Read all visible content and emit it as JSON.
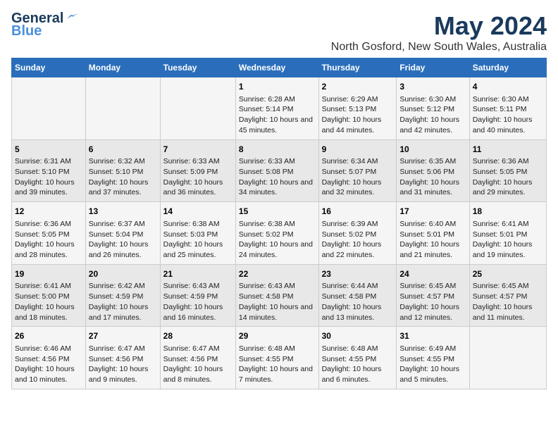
{
  "header": {
    "logo_line1": "General",
    "logo_line2": "Blue",
    "main_title": "May 2024",
    "subtitle": "North Gosford, New South Wales, Australia"
  },
  "days_of_week": [
    "Sunday",
    "Monday",
    "Tuesday",
    "Wednesday",
    "Thursday",
    "Friday",
    "Saturday"
  ],
  "weeks": [
    [
      {
        "num": "",
        "info": ""
      },
      {
        "num": "",
        "info": ""
      },
      {
        "num": "",
        "info": ""
      },
      {
        "num": "1",
        "info": "Sunrise: 6:28 AM\nSunset: 5:14 PM\nDaylight: 10 hours and 45 minutes."
      },
      {
        "num": "2",
        "info": "Sunrise: 6:29 AM\nSunset: 5:13 PM\nDaylight: 10 hours and 44 minutes."
      },
      {
        "num": "3",
        "info": "Sunrise: 6:30 AM\nSunset: 5:12 PM\nDaylight: 10 hours and 42 minutes."
      },
      {
        "num": "4",
        "info": "Sunrise: 6:30 AM\nSunset: 5:11 PM\nDaylight: 10 hours and 40 minutes."
      }
    ],
    [
      {
        "num": "5",
        "info": "Sunrise: 6:31 AM\nSunset: 5:10 PM\nDaylight: 10 hours and 39 minutes."
      },
      {
        "num": "6",
        "info": "Sunrise: 6:32 AM\nSunset: 5:10 PM\nDaylight: 10 hours and 37 minutes."
      },
      {
        "num": "7",
        "info": "Sunrise: 6:33 AM\nSunset: 5:09 PM\nDaylight: 10 hours and 36 minutes."
      },
      {
        "num": "8",
        "info": "Sunrise: 6:33 AM\nSunset: 5:08 PM\nDaylight: 10 hours and 34 minutes."
      },
      {
        "num": "9",
        "info": "Sunrise: 6:34 AM\nSunset: 5:07 PM\nDaylight: 10 hours and 32 minutes."
      },
      {
        "num": "10",
        "info": "Sunrise: 6:35 AM\nSunset: 5:06 PM\nDaylight: 10 hours and 31 minutes."
      },
      {
        "num": "11",
        "info": "Sunrise: 6:36 AM\nSunset: 5:05 PM\nDaylight: 10 hours and 29 minutes."
      }
    ],
    [
      {
        "num": "12",
        "info": "Sunrise: 6:36 AM\nSunset: 5:05 PM\nDaylight: 10 hours and 28 minutes."
      },
      {
        "num": "13",
        "info": "Sunrise: 6:37 AM\nSunset: 5:04 PM\nDaylight: 10 hours and 26 minutes."
      },
      {
        "num": "14",
        "info": "Sunrise: 6:38 AM\nSunset: 5:03 PM\nDaylight: 10 hours and 25 minutes."
      },
      {
        "num": "15",
        "info": "Sunrise: 6:38 AM\nSunset: 5:02 PM\nDaylight: 10 hours and 24 minutes."
      },
      {
        "num": "16",
        "info": "Sunrise: 6:39 AM\nSunset: 5:02 PM\nDaylight: 10 hours and 22 minutes."
      },
      {
        "num": "17",
        "info": "Sunrise: 6:40 AM\nSunset: 5:01 PM\nDaylight: 10 hours and 21 minutes."
      },
      {
        "num": "18",
        "info": "Sunrise: 6:41 AM\nSunset: 5:01 PM\nDaylight: 10 hours and 19 minutes."
      }
    ],
    [
      {
        "num": "19",
        "info": "Sunrise: 6:41 AM\nSunset: 5:00 PM\nDaylight: 10 hours and 18 minutes."
      },
      {
        "num": "20",
        "info": "Sunrise: 6:42 AM\nSunset: 4:59 PM\nDaylight: 10 hours and 17 minutes."
      },
      {
        "num": "21",
        "info": "Sunrise: 6:43 AM\nSunset: 4:59 PM\nDaylight: 10 hours and 16 minutes."
      },
      {
        "num": "22",
        "info": "Sunrise: 6:43 AM\nSunset: 4:58 PM\nDaylight: 10 hours and 14 minutes."
      },
      {
        "num": "23",
        "info": "Sunrise: 6:44 AM\nSunset: 4:58 PM\nDaylight: 10 hours and 13 minutes."
      },
      {
        "num": "24",
        "info": "Sunrise: 6:45 AM\nSunset: 4:57 PM\nDaylight: 10 hours and 12 minutes."
      },
      {
        "num": "25",
        "info": "Sunrise: 6:45 AM\nSunset: 4:57 PM\nDaylight: 10 hours and 11 minutes."
      }
    ],
    [
      {
        "num": "26",
        "info": "Sunrise: 6:46 AM\nSunset: 4:56 PM\nDaylight: 10 hours and 10 minutes."
      },
      {
        "num": "27",
        "info": "Sunrise: 6:47 AM\nSunset: 4:56 PM\nDaylight: 10 hours and 9 minutes."
      },
      {
        "num": "28",
        "info": "Sunrise: 6:47 AM\nSunset: 4:56 PM\nDaylight: 10 hours and 8 minutes."
      },
      {
        "num": "29",
        "info": "Sunrise: 6:48 AM\nSunset: 4:55 PM\nDaylight: 10 hours and 7 minutes."
      },
      {
        "num": "30",
        "info": "Sunrise: 6:48 AM\nSunset: 4:55 PM\nDaylight: 10 hours and 6 minutes."
      },
      {
        "num": "31",
        "info": "Sunrise: 6:49 AM\nSunset: 4:55 PM\nDaylight: 10 hours and 5 minutes."
      },
      {
        "num": "",
        "info": ""
      }
    ]
  ],
  "colors": {
    "header_bg": "#2a6ebb",
    "title_color": "#1a3a5c"
  }
}
